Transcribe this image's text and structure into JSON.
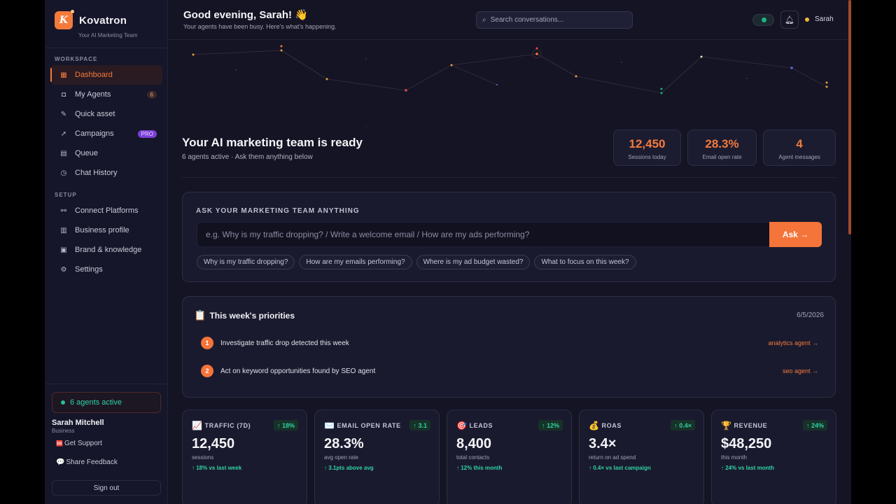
{
  "brand": {
    "name": "Kovatron",
    "tagline": "Your AI Marketing Team",
    "logo_letter": "K"
  },
  "sidebar": {
    "workspace_label": "WORKSPACE",
    "workspace_items": [
      {
        "label": "Dashboard",
        "icon": "grid-icon",
        "active": true
      },
      {
        "label": "My Agents",
        "icon": "robot-icon",
        "badge": "6"
      },
      {
        "label": "Quick asset",
        "icon": "magic-wand-icon"
      },
      {
        "label": "Campaigns",
        "icon": "rocket-icon",
        "badge": "PRO"
      },
      {
        "label": "Queue",
        "icon": "clipboard-icon"
      },
      {
        "label": "Chat History",
        "icon": "history-icon"
      }
    ],
    "setup_label": "SETUP",
    "setup_items": [
      {
        "label": "Connect Platforms",
        "icon": "link-icon"
      },
      {
        "label": "Business profile",
        "icon": "building-icon"
      },
      {
        "label": "Brand & knowledge",
        "icon": "book-icon"
      },
      {
        "label": "Settings",
        "icon": "gear-icon"
      }
    ],
    "agents_active": "6 agents active",
    "user_name": "Sarah Mitchell",
    "user_plan": "Business",
    "support": "Get Support",
    "feedback": "Share Feedback",
    "sign_out": "Sign out"
  },
  "header": {
    "greeting": "Good evening, Sarah! 👋",
    "subtitle": "Your agents have been busy. Here's what's happening.",
    "search_placeholder": "Search conversations...",
    "user": "Sarah"
  },
  "hero": {
    "title": "Your AI marketing team is ready",
    "subtitle": "6 agents active · Ask them anything below",
    "stats": [
      {
        "value": "12,450",
        "label": "Sessions today"
      },
      {
        "value": "28.3%",
        "label": "Email open rate"
      },
      {
        "value": "4",
        "label": "Agent messages"
      }
    ]
  },
  "ask": {
    "label": "ASK YOUR MARKETING TEAM ANYTHING",
    "placeholder": "e.g. Why is my traffic dropping? / Write a welcome email / How are my ads performing?",
    "button": "Ask →",
    "chips": [
      "Why is my traffic dropping?",
      "How are my emails performing?",
      "Where is my ad budget wasted?",
      "What to focus on this week?"
    ]
  },
  "priorities": {
    "title": "This week's priorities",
    "date": "6/5/2026",
    "items": [
      {
        "num": "1",
        "text": "Investigate traffic drop detected this week",
        "link": "analytics agent →"
      },
      {
        "num": "2",
        "text": "Act on keyword opportunities found by SEO agent",
        "link": "seo agent →"
      }
    ]
  },
  "metrics": [
    {
      "icon": "chart-up-icon",
      "emoji": "📈",
      "label": "TRAFFIC (7D)",
      "badge": "↑ 18%",
      "value": "12,450",
      "sub": "sessions",
      "delta": "↑ 18% vs last week"
    },
    {
      "icon": "envelope-icon",
      "emoji": "✉️",
      "label": "EMAIL OPEN RATE",
      "badge": "↑ 3.1",
      "value": "28.3%",
      "sub": "avg open rate",
      "delta": "↑ 3.1pts above avg"
    },
    {
      "icon": "target-icon",
      "emoji": "🎯",
      "label": "LEADS",
      "badge": "↑ 12%",
      "value": "8,400",
      "sub": "total contacts",
      "delta": "↑ 12% this month"
    },
    {
      "icon": "money-bag-icon",
      "emoji": "💰",
      "label": "ROAS",
      "badge": "↑ 0.4×",
      "value": "3.4×",
      "sub": "return on ad spend",
      "delta": "↑ 0.4× vs last campaign"
    },
    {
      "icon": "trophy-icon",
      "emoji": "🏆",
      "label": "REVENUE",
      "badge": "↑ 24%",
      "value": "$48,250",
      "sub": "this month",
      "delta": "↑ 24% vs last month"
    }
  ],
  "colors": {
    "accent": "#f4743a",
    "success": "#2fd3a5",
    "bg": "#141424",
    "card": "#1a1a2e"
  }
}
